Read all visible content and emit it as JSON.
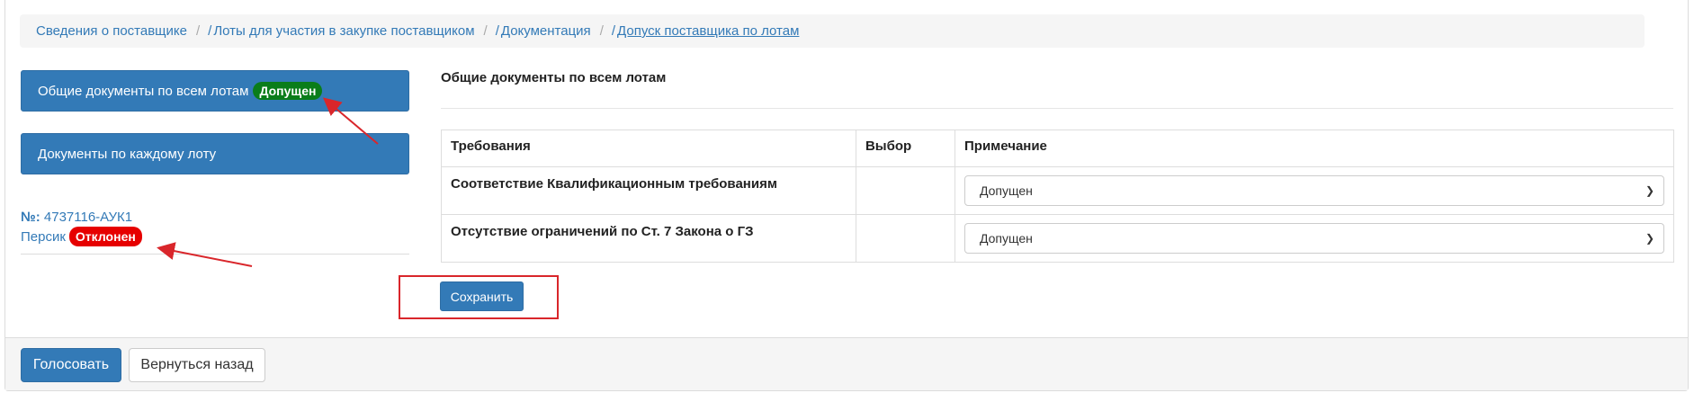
{
  "breadcrumb": {
    "items": [
      {
        "label": "Сведения о поставщике"
      },
      {
        "label": "Лоты для участия в закупке поставщиком"
      },
      {
        "label": "Документация"
      },
      {
        "label": "Допуск поставщика по лотам"
      }
    ]
  },
  "sidebar": {
    "general_docs_label": "Общие документы по всем лотам",
    "general_docs_badge": "Допущен",
    "per_lot_docs_label": "Документы по каждому лоту",
    "lot_number_label": "№:",
    "lot_number_value": "4737116-АУК1",
    "supplier_name": "Персик",
    "supplier_status": "Отклонен"
  },
  "main": {
    "section_title": "Общие документы по всем лотам",
    "table": {
      "headers": [
        "Требования",
        "Выбор",
        "Примечание"
      ],
      "rows": [
        {
          "requirement": "Соответствие Квалификационным требованиям",
          "choice": "",
          "note": "Допущен"
        },
        {
          "requirement": "Отсутствие ограничений по Ст. 7 Закона о ГЗ",
          "choice": "",
          "note": "Допущен"
        }
      ]
    },
    "save_label": "Сохранить"
  },
  "footer": {
    "vote_label": "Голосовать",
    "back_label": "Вернуться назад"
  },
  "colors": {
    "primary": "#337ab7",
    "approved": "#0a7d1a",
    "rejected": "#e60000",
    "annotation": "#d9262b"
  }
}
